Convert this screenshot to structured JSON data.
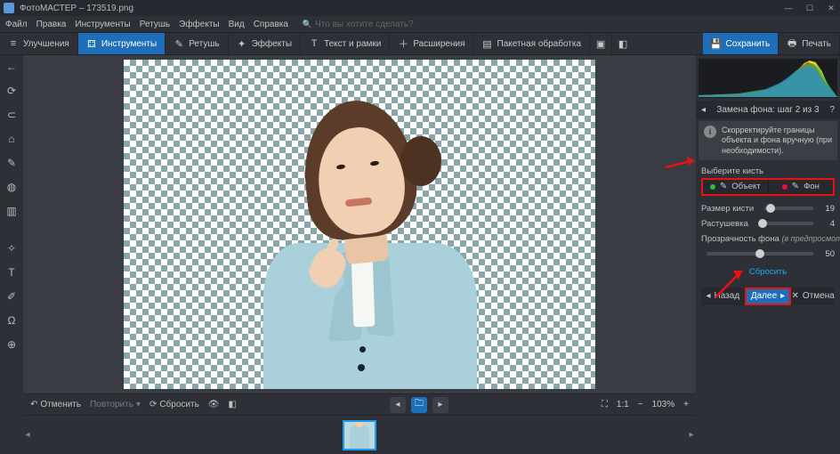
{
  "titlebar": {
    "app": "ФотоМАСТЕР",
    "file": "173519.png"
  },
  "menu": {
    "file": "Файл",
    "edit": "Правка",
    "tools": "Инструменты",
    "retouch": "Ретушь",
    "effects": "Эффекты",
    "view": "Вид",
    "help": "Справка",
    "search_placeholder": "Что вы хотите сделать?"
  },
  "toolbar": {
    "improve": "Улучшения",
    "tools": "Инструменты",
    "retouch": "Ретушь",
    "effects": "Эффекты",
    "text": "Текст и рамки",
    "extensions": "Расширения",
    "batch": "Пакетная обработка",
    "save": "Сохранить",
    "print": "Печать"
  },
  "bottombar": {
    "undo": "Отменить",
    "redo": "Повторить",
    "reset": "Сбросить",
    "zoom_ratio": "1:1",
    "zoom_pct": "103%"
  },
  "panel": {
    "title": "Замена фона: шаг 2 из 3",
    "hint": "Скорректируйте границы объекта и фона вручную (при необходимости).",
    "pick_brush": "Выберите кисть",
    "brush_object": "Объект",
    "brush_bg": "Фон",
    "size_label": "Размер кисти",
    "size_value": "19",
    "feather_label": "Растушевка",
    "feather_value": "4",
    "opacity_label": "Прозрачность фона",
    "opacity_note": "(в предпросмотре)",
    "opacity_value": "50",
    "reset": "Сбросить",
    "back": "Назад",
    "next": "Далее",
    "cancel": "Отмена"
  }
}
